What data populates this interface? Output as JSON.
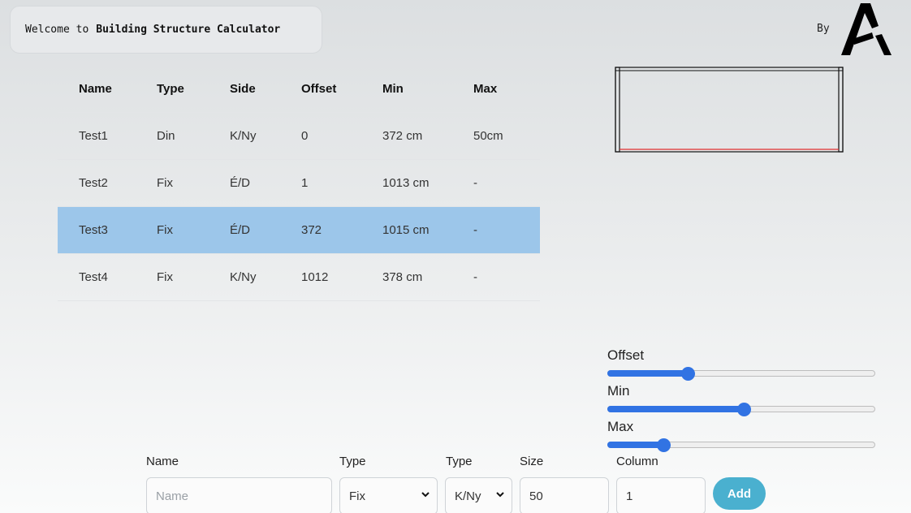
{
  "header": {
    "welcome_prefix": "Welcome to",
    "app_name": "Building Structure Calculator",
    "by_label": "By"
  },
  "table": {
    "columns": [
      "Name",
      "Type",
      "Side",
      "Offset",
      "Min",
      "Max"
    ],
    "rows": [
      {
        "name": "Test1",
        "type": "Din",
        "side": "K/Ny",
        "offset": "0",
        "min": "372 cm",
        "max": "50cm",
        "selected": false
      },
      {
        "name": "Test2",
        "type": "Fix",
        "side": "É/D",
        "offset": "1",
        "min": "1013 cm",
        "max": "-",
        "selected": false
      },
      {
        "name": "Test3",
        "type": "Fix",
        "side": "É/D",
        "offset": "372",
        "min": "1015 cm",
        "max": "-",
        "selected": true
      },
      {
        "name": "Test4",
        "type": "Fix",
        "side": "K/Ny",
        "offset": "1012",
        "min": "378 cm",
        "max": "-",
        "selected": false
      }
    ]
  },
  "sliders": {
    "offset": {
      "label": "Offset",
      "value": 0.3
    },
    "min": {
      "label": "Min",
      "value": 0.51
    },
    "max": {
      "label": "Max",
      "value": 0.21
    }
  },
  "form": {
    "name_label": "Name",
    "name_placeholder": "Name",
    "type_label": "Type",
    "type_value": "Fix",
    "side_label": "Type",
    "side_value": "K/Ny",
    "size_label": "Size",
    "size_value": "50",
    "column_label": "Column",
    "column_value": "1",
    "add_label": "Add"
  },
  "colors": {
    "selected_row": "#9cc6ea",
    "slider_accent": "#3173e3",
    "add_button": "#4ab0cf",
    "preview_line": "#e03030"
  }
}
